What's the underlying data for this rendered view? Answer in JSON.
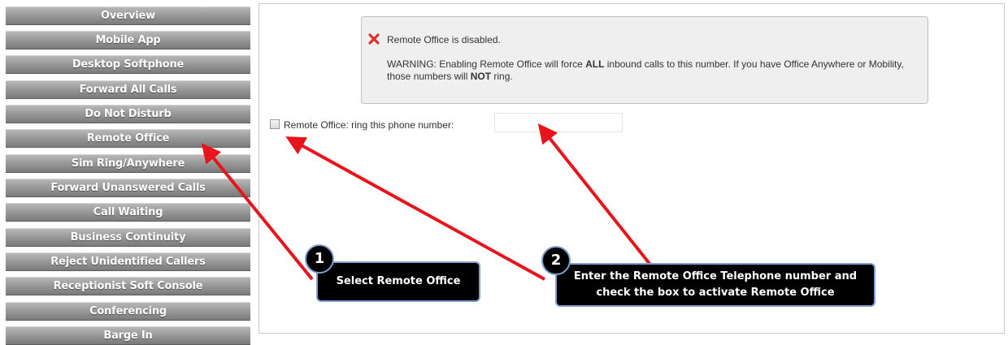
{
  "sidebar": {
    "items": [
      {
        "label": "Overview"
      },
      {
        "label": "Mobile App"
      },
      {
        "label": "Desktop Softphone"
      },
      {
        "label": "Forward All Calls"
      },
      {
        "label": "Do Not Disturb"
      },
      {
        "label": "Remote Office"
      },
      {
        "label": "Sim Ring/Anywhere"
      },
      {
        "label": "Forward Unanswered Calls"
      },
      {
        "label": "Call Waiting"
      },
      {
        "label": "Business Continuity"
      },
      {
        "label": "Reject Unidentified Callers"
      },
      {
        "label": "Receptionist Soft Console"
      },
      {
        "label": "Conferencing"
      },
      {
        "label": "Barge In"
      }
    ]
  },
  "alert": {
    "icon": "close-x-icon",
    "icon_color": "#e0302a",
    "title": "Remote Office is disabled.",
    "warning_prefix": "WARNING: Enabling Remote Office will force ",
    "warning_bold1": "ALL",
    "warning_mid": " inbound calls to this number. If you have Office Anywhere or Mobility, those numbers will ",
    "warning_bold2": "NOT",
    "warning_suffix": " ring."
  },
  "remote_office": {
    "checkbox_checked": false,
    "label": "Remote Office: ring this phone number:",
    "phone_value": ""
  },
  "callouts": {
    "step1_number": "1",
    "step1_text": "Select Remote Office",
    "step2_number": "2",
    "step2_line1": "Enter the Remote Office Telephone number and",
    "step2_line2": "check the box to activate Remote Office",
    "arrow_color": "#e8141b"
  }
}
